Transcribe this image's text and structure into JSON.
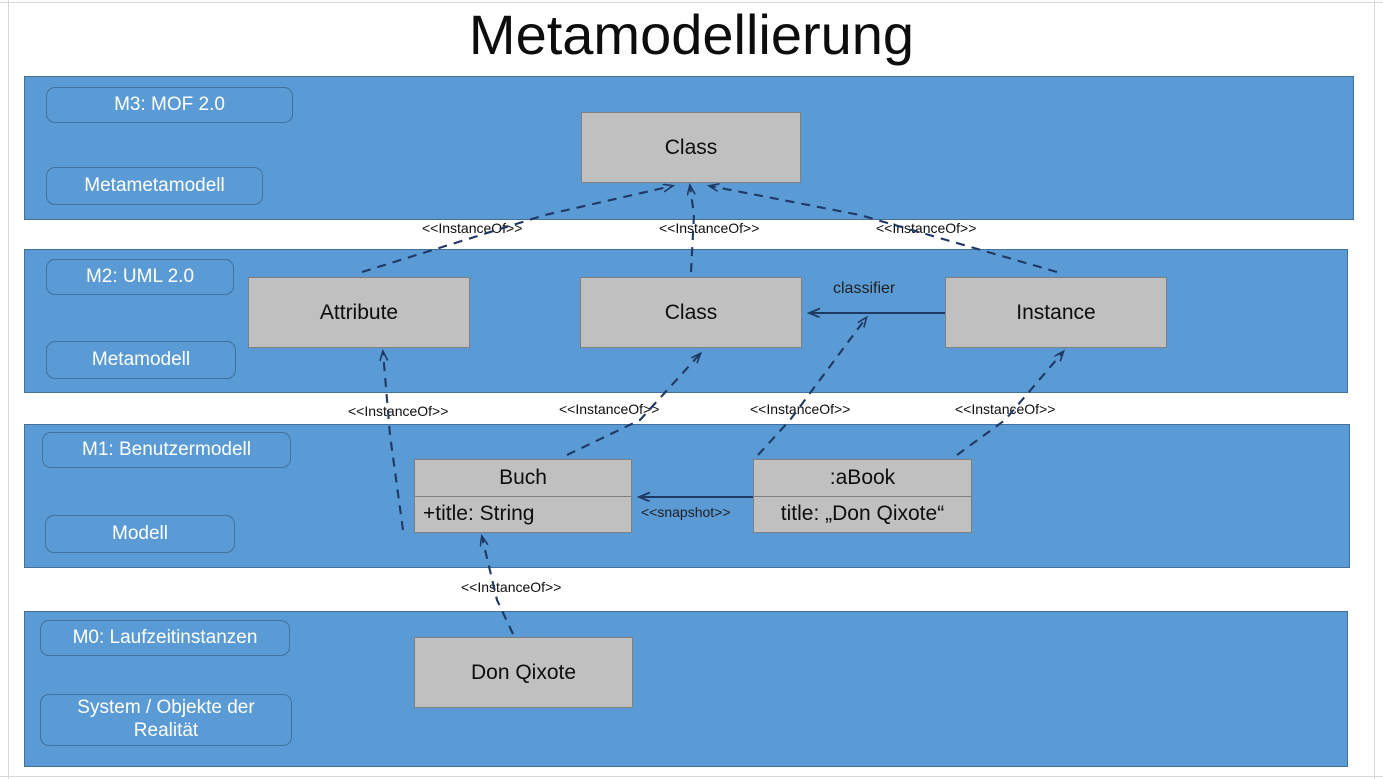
{
  "page": {
    "title": "Metamodellierung",
    "colors": {
      "band_fill": "#5B9BD5",
      "band_border": "#41719C",
      "box_fill": "#C0C0C0",
      "box_border": "#7F7F7F",
      "tag_text": "#FFFFFF",
      "arrow": "#1F3864",
      "background": "#FFFFFF"
    }
  },
  "layers": [
    {
      "id": "M3",
      "level_label": "M3: MOF 2.0",
      "role_label": "Metametamodell",
      "elements": [
        {
          "name": "Class"
        }
      ]
    },
    {
      "id": "M2",
      "level_label": "M2: UML 2.0",
      "role_label": "Metamodell",
      "elements": [
        {
          "name": "Attribute"
        },
        {
          "name": "Class"
        },
        {
          "name": "Instance"
        }
      ]
    },
    {
      "id": "M1",
      "level_label": "M1: Benutzermodell",
      "role_label": "Modell",
      "elements": [
        {
          "name": "Buch",
          "attribute": "+title: String"
        },
        {
          "name": ":aBook",
          "attribute": "title: „Don Qixote“"
        }
      ]
    },
    {
      "id": "M0",
      "level_label": "M0: Laufzeitinstanzen",
      "role_label": "System / Objekte der Realität",
      "elements": [
        {
          "name": "Don Qixote"
        }
      ]
    }
  ],
  "edge_labels": {
    "instance_of": "<<InstanceOf>>",
    "snapshot": "<<snapshot>>",
    "classifier": "classifier"
  },
  "edges": [
    {
      "label": "<<InstanceOf>>",
      "from": "M2.Attribute",
      "to": "M3.Class"
    },
    {
      "label": "<<InstanceOf>>",
      "from": "M2.Class",
      "to": "M3.Class"
    },
    {
      "label": "<<InstanceOf>>",
      "from": "M2.Instance",
      "to": "M3.Class"
    },
    {
      "label": "<<InstanceOf>>",
      "from": "M1.Buch.title",
      "to": "M2.Attribute"
    },
    {
      "label": "<<InstanceOf>>",
      "from": "M1.Buch",
      "to": "M2.Class"
    },
    {
      "label": "<<InstanceOf>>",
      "from": "M1.aBook",
      "to": "M2.Instance-classifier"
    },
    {
      "label": "<<InstanceOf>>",
      "from": "M1.aBook",
      "to": "M2.Instance"
    },
    {
      "label": "<<InstanceOf>>",
      "from": "M0.DonQixote",
      "to": "M1.Buch.title"
    },
    {
      "label": "<<snapshot>>",
      "from": "M1.aBook",
      "to": "M1.Buch"
    },
    {
      "label": "classifier",
      "from": "M2.Instance",
      "to": "M2.Class"
    }
  ]
}
